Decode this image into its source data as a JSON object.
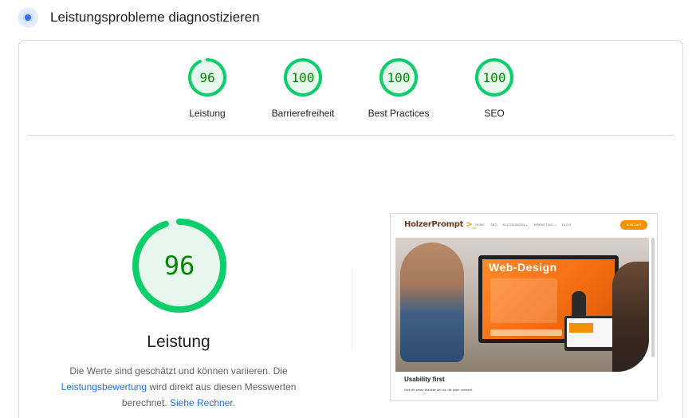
{
  "header": {
    "title": "Leistungsprobleme diagnostizieren",
    "icon": "lighthouse-icon"
  },
  "colors": {
    "pass": "#0cce6b",
    "pass_text": "#008800",
    "pass_fill": "#e8f7ed",
    "link": "#1a73e8"
  },
  "gauges": [
    {
      "score": "96",
      "label": "Leistung",
      "value": 96
    },
    {
      "score": "100",
      "label": "Barrierefreiheit",
      "value": 100
    },
    {
      "score": "100",
      "label": "Best Practices",
      "value": 100
    },
    {
      "score": "100",
      "label": "SEO",
      "value": 100
    }
  ],
  "main": {
    "score": "96",
    "value": 96,
    "title": "Leistung",
    "desc_part1": "Die Werte sind geschätzt und können variieren. Die",
    "desc_link1": "Leistungsbewertung",
    "desc_part2": "wird direkt aus diesen Messwerten berechnet.",
    "desc_link2": "Siehe Rechner",
    "desc_end": "."
  },
  "screenshot": {
    "logo": "HolzerPrompt",
    "logo_arrow": ">_",
    "nav": [
      "HOME",
      "SEO",
      "KI-LÖSUNGEN ⌄",
      "MARKETING ⌄",
      "BLOG"
    ],
    "cta": "KONTAKT",
    "hero_title": "Web-Design",
    "usability_title": "Usability first",
    "usability_sub": "Wirf die beste Website der Ist, die jeder versteht."
  }
}
